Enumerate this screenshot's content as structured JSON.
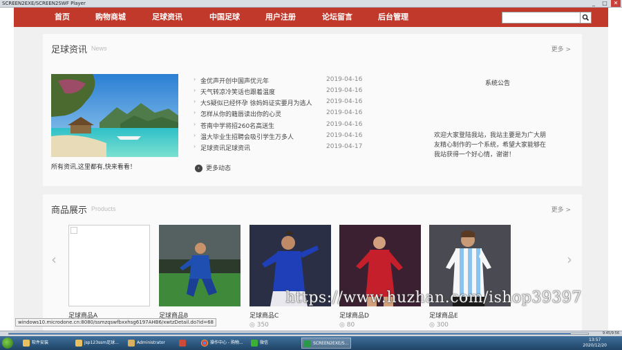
{
  "player": {
    "title": "SCREEN2EXE/SCREEN2SWF Player",
    "controls": [
      "_",
      "□",
      "✕"
    ],
    "time": "9:45/9:56"
  },
  "nav": {
    "items": [
      "首页",
      "购物商城",
      "足球资讯",
      "中国足球",
      "用户注册",
      "论坛留言",
      "后台管理"
    ],
    "search_placeholder": ""
  },
  "news": {
    "title": "足球资讯",
    "subtitle": "News",
    "more": "更多 >",
    "caption": "所有资讯,这里都有,快来看看！",
    "items": [
      {
        "title": "金优声开创中国声优元年",
        "date": "2019-04-16"
      },
      {
        "title": "天气转凉冷笑话也跟着温度",
        "date": "2019-04-16"
      },
      {
        "title": "大S疑似已经怀孕 徐妈妈证实要月为逃人",
        "date": "2019-04-16"
      },
      {
        "title": "怎样从你的籍唇读出你的心灵",
        "date": "2019-04-16"
      },
      {
        "title": "苍南中学将招260名高送生",
        "date": "2019-04-16"
      },
      {
        "title": "温大毕业生招聘会吸引学生万多人",
        "date": "2019-04-16"
      },
      {
        "title": "足球资讯足球资讯",
        "date": "2019-04-17"
      }
    ],
    "more_news": "更多动态"
  },
  "notice": {
    "title": "系统公告",
    "text": "欢迎大家登陆我站，我站主要是为广大朋友精心制作的一个系统，希望大家能够在我站获得一个好心情，谢谢！"
  },
  "products": {
    "title": "商品展示",
    "subtitle": "Products",
    "more": "更多 >",
    "items": [
      {
        "name": "足球商品A",
        "price": ""
      },
      {
        "name": "足球商品B",
        "price": ""
      },
      {
        "name": "足球商品C",
        "price": "350"
      },
      {
        "name": "足球商品D",
        "price": "80"
      },
      {
        "name": "足球商品E",
        "price": "300"
      }
    ]
  },
  "status_url": "windows10.microdone.cn:8080/ssmzqswfbxxhsg6197AHB6/xwtzDetail.do?id=68",
  "watermark": "https://www.huzhan.com/ishop39397",
  "taskbar": {
    "items": [
      "软件安装",
      "jsp123ssm足球...",
      "Administrator",
      "",
      "操作中心 - 购物...",
      "微信",
      "SCREEN2EXE/S..."
    ],
    "time": "13:57",
    "date": "2020/12/20"
  },
  "colors": {
    "nav_bg": "#c0392b",
    "page_bg": "#f0f0f0",
    "panel_bg": "#fafafa"
  }
}
